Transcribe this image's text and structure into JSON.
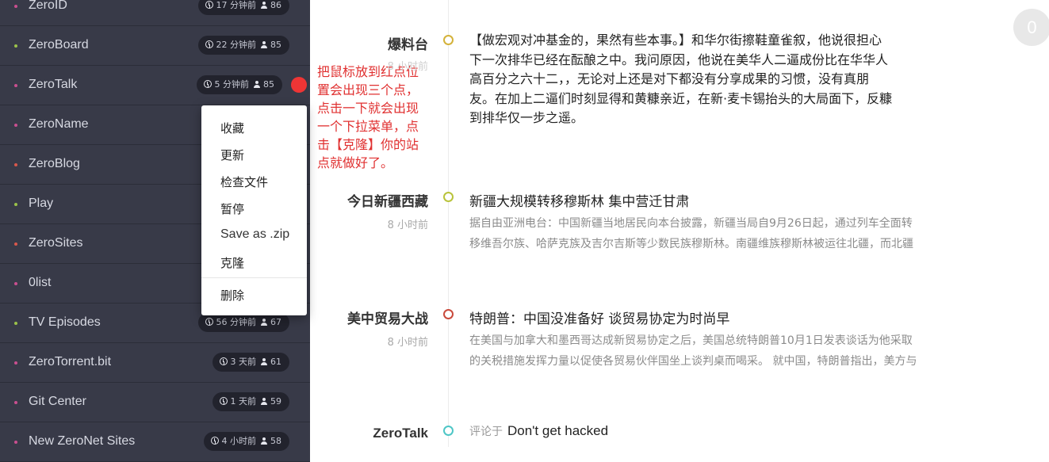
{
  "sidebar": {
    "sites": [
      {
        "name": "ZeroID",
        "time": "17 分钟前",
        "peers": "86",
        "dot_color": "#c94f8f"
      },
      {
        "name": "ZeroBoard",
        "time": "22 分钟前",
        "peers": "85",
        "dot_color": "#9bc24a"
      },
      {
        "name": "ZeroTalk",
        "time": "5 分钟前",
        "peers": "85",
        "dot_color": "#c94f8f"
      },
      {
        "name": "ZeroName",
        "time": "",
        "peers": "",
        "dot_color": "#c94f8f"
      },
      {
        "name": "ZeroBlog",
        "time": "",
        "peers": "",
        "dot_color": "#d9584c"
      },
      {
        "name": "Play",
        "time": "",
        "peers": "",
        "dot_color": "#9bc24a"
      },
      {
        "name": "ZeroSites",
        "time": "",
        "peers": "",
        "dot_color": "#d9584c"
      },
      {
        "name": "0list",
        "time": "",
        "peers": "",
        "dot_color": "#c94f8f"
      },
      {
        "name": "TV Episodes",
        "time": "56 分钟前",
        "peers": "67",
        "dot_color": "#9bc24a"
      },
      {
        "name": "ZeroTorrent.bit",
        "time": "3 天前",
        "peers": "61",
        "dot_color": "#c94f8f"
      },
      {
        "name": "Git Center",
        "time": "1 天前",
        "peers": "59",
        "dot_color": "#c94f8f"
      },
      {
        "name": "New ZeroNet Sites",
        "time": "4 小时前",
        "peers": "58",
        "dot_color": "#c94f8f"
      }
    ]
  },
  "context_menu": {
    "items": [
      "收藏",
      "更新",
      "检查文件",
      "暂停",
      "Save as .zip",
      "克隆",
      "删除"
    ]
  },
  "annotation": {
    "lines": [
      "把鼠标放到红点位",
      "置会出现三个点，",
      "点击一下就会出现",
      "一个下拉菜单，点",
      "击【克隆】你的站",
      "点就做好了。"
    ],
    "color": "#e03030"
  },
  "feed": {
    "posts": [
      {
        "source": "爆料台",
        "time": "8 小时前",
        "node_color": "#d4b23a",
        "body_lines": [
          "【做宏观对冲基金的，果然有些本事。】和华尔街擦鞋童雀叙，他说很担心",
          "下一次排华已经在酝酿之中。我问原因，他说在美华人二逼成份比在华华人",
          "高百分之六十二，，无论对上还是对下都没有分享成果的习惯，没有真朋",
          "友。在加上二逼们时刻显得和黄糠亲近，在新·麦卡锡抬头的大局面下，反糠",
          "到排华仅一步之遥。"
        ]
      },
      {
        "source": "今日新疆西藏",
        "time": "8 小时前",
        "node_color": "#b9c33b",
        "title": "新疆大规模转移穆斯林 集中营迁甘肃",
        "excerpt_lines": [
          "据自由亚洲电台：中国新疆当地居民向本台披露，新疆当局自9月26日起，通过列车全面转",
          "移维吾尔族、哈萨克族及吉尔吉斯等少数民族穆斯林。南疆维族穆斯林被运往北疆，而北疆"
        ]
      },
      {
        "source": "美中贸易大战",
        "time": "8 小时前",
        "node_color": "#c94a3c",
        "title": "特朗普：中国没准备好 谈贸易协定为时尚早",
        "excerpt_lines": [
          "在美国与加拿大和墨西哥达成新贸易协定之后，美国总统特朗普10月1日发表谈话为他采取",
          "的关税措施发挥力量以促使各贸易伙伴国坐上谈判桌而喝采。 就中国，特朗普指出，美方与"
        ]
      },
      {
        "source": "ZeroTalk",
        "node_color": "#4ec6c6",
        "comment_prefix": "评论于",
        "title": "Don't get hacked"
      }
    ]
  },
  "notification": {
    "count": "0"
  }
}
